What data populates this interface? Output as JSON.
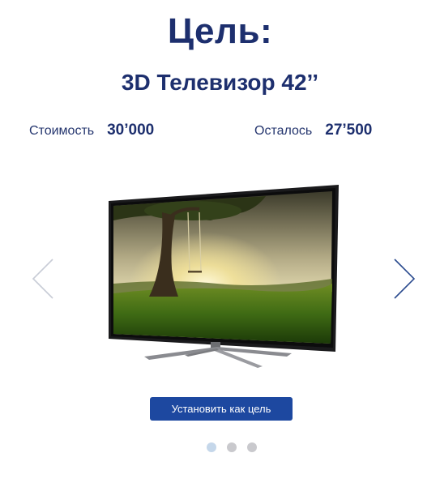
{
  "goal": {
    "heading": "Цель:",
    "product_name": "3D Телевизор 42’’"
  },
  "stats": {
    "cost_label": "Стоимость",
    "cost_value": "30’000",
    "remaining_label": "Осталось",
    "remaining_value": "27’500"
  },
  "carousel": {
    "prev_icon": "chevron-left-icon",
    "next_icon": "chevron-right-icon",
    "image_icon": "tv-image",
    "dots_count": 3,
    "active_dot": 1
  },
  "cta": {
    "label": "Установить как цель",
    "color": "#1d48a0"
  },
  "colors": {
    "heading": "#1d2f6e",
    "dot_active": "#c5d7ea",
    "dot_inactive": "#c9c9cd"
  }
}
